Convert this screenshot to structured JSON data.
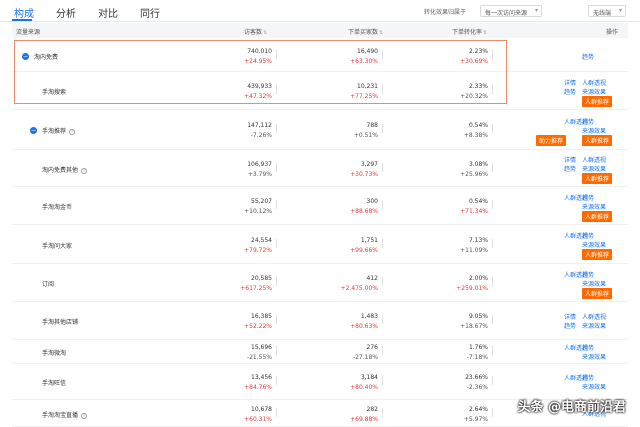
{
  "tabs": [
    {
      "label": "构成",
      "active": true
    },
    {
      "label": "分析",
      "active": false
    },
    {
      "label": "对比",
      "active": false
    },
    {
      "label": "同行",
      "active": false
    }
  ],
  "attribution_label": "转化效果归属于",
  "attribution_select": "每一次访问来源",
  "terminal_select": "无线端",
  "columns": {
    "source": "流量来源",
    "visitors": "访客数",
    "buyers": "下单买家数",
    "conversion": "下单转化率",
    "ops": "操作"
  },
  "rows": [
    {
      "name": "淘内免费",
      "level": 0,
      "expanded": true,
      "help": false,
      "visitors": "740,010",
      "visitors_chg": "+24.95%",
      "visitors_pos": true,
      "buyers": "16,490",
      "buyers_chg": "+63.30%",
      "buyers_pos": true,
      "conv": "2.23%",
      "conv_chg": "+30.69%",
      "conv_pos": true,
      "ops": {
        "links": [
          "趋势"
        ],
        "badges": []
      }
    },
    {
      "name": "手淘搜索",
      "level": 1,
      "expanded": false,
      "help": false,
      "visitors": "439,933",
      "visitors_chg": "+47.32%",
      "visitors_pos": true,
      "buyers": "10,231",
      "buyers_chg": "+77.25%",
      "buyers_pos": true,
      "conv": "2.33%",
      "conv_chg": "+20.32%",
      "conv_pos": false,
      "ops": {
        "links": [
          "详情",
          "人群透视",
          "趋势",
          "来源效果"
        ],
        "badges": [
          "人群推荐"
        ]
      }
    },
    {
      "name": "手淘推荐",
      "level": 1,
      "expanded": true,
      "help": true,
      "visitors": "147,112",
      "visitors_chg": "-7.26%",
      "visitors_pos": false,
      "buyers": "788",
      "buyers_chg": "+0.51%",
      "buyers_pos": false,
      "conv": "0.54%",
      "conv_chg": "+8.38%",
      "conv_pos": false,
      "ops": {
        "links": [
          "人群透视",
          "趋势",
          "来源效果"
        ],
        "badges": [
          "助力推荐",
          "人群推荐"
        ]
      }
    },
    {
      "name": "淘内免费其他",
      "level": 1,
      "expanded": false,
      "help": true,
      "visitors": "106,937",
      "visitors_chg": "+3.79%",
      "visitors_pos": false,
      "buyers": "3,297",
      "buyers_chg": "+30.73%",
      "buyers_pos": true,
      "conv": "3.08%",
      "conv_chg": "+25.96%",
      "conv_pos": false,
      "ops": {
        "links": [
          "详情",
          "人群透视",
          "趋势",
          "来源效果"
        ],
        "badges": [
          "人群推荐"
        ]
      }
    },
    {
      "name": "手淘淘金币",
      "level": 1,
      "expanded": false,
      "help": false,
      "visitors": "55,207",
      "visitors_chg": "+10.12%",
      "visitors_pos": false,
      "buyers": "300",
      "buyers_chg": "+88.68%",
      "buyers_pos": true,
      "conv": "0.54%",
      "conv_chg": "+71.34%",
      "conv_pos": true,
      "ops": {
        "links": [
          "人群透视",
          "趋势",
          "来源效果"
        ],
        "badges": [
          "人群推荐"
        ]
      }
    },
    {
      "name": "手淘问大家",
      "level": 1,
      "expanded": false,
      "help": false,
      "visitors": "24,554",
      "visitors_chg": "+79.72%",
      "visitors_pos": true,
      "buyers": "1,751",
      "buyers_chg": "+99.66%",
      "buyers_pos": true,
      "conv": "7.13%",
      "conv_chg": "+11.09%",
      "conv_pos": false,
      "ops": {
        "links": [
          "人群透视",
          "趋势",
          "来源效果"
        ],
        "badges": [
          "人群推荐"
        ]
      }
    },
    {
      "name": "订阅",
      "level": 1,
      "expanded": false,
      "help": false,
      "visitors": "20,585",
      "visitors_chg": "+617.25%",
      "visitors_pos": true,
      "buyers": "412",
      "buyers_chg": "+2,475.00%",
      "buyers_pos": true,
      "conv": "2.00%",
      "conv_chg": "+259.01%",
      "conv_pos": true,
      "ops": {
        "links": [
          "人群透视",
          "趋势",
          "来源效果"
        ],
        "badges": [
          "人群推荐"
        ]
      }
    },
    {
      "name": "手淘其他店铺",
      "level": 1,
      "expanded": false,
      "help": false,
      "visitors": "16,385",
      "visitors_chg": "+52.22%",
      "visitors_pos": true,
      "buyers": "1,483",
      "buyers_chg": "+80.63%",
      "buyers_pos": true,
      "conv": "9.05%",
      "conv_chg": "+18.67%",
      "conv_pos": false,
      "ops": {
        "links": [
          "详情",
          "人群透视",
          "趋势",
          "来源效果"
        ],
        "badges": []
      }
    },
    {
      "name": "手淘微淘",
      "level": 1,
      "expanded": false,
      "help": false,
      "visitors": "15,696",
      "visitors_chg": "-21.55%",
      "visitors_pos": false,
      "buyers": "276",
      "buyers_chg": "-27.18%",
      "buyers_pos": false,
      "conv": "1.76%",
      "conv_chg": "-7.18%",
      "conv_pos": false,
      "ops": {
        "links": [
          "人群透视",
          "趋势",
          "来源效果"
        ],
        "badges": []
      }
    },
    {
      "name": "手淘旺信",
      "level": 1,
      "expanded": false,
      "help": false,
      "visitors": "13,456",
      "visitors_chg": "+84.76%",
      "visitors_pos": true,
      "buyers": "3,184",
      "buyers_chg": "+80.40%",
      "buyers_pos": true,
      "conv": "23.66%",
      "conv_chg": "-2.36%",
      "conv_pos": false,
      "ops": {
        "links": [
          "人群透视",
          "趋势",
          "来源效果"
        ],
        "badges": []
      }
    },
    {
      "name": "手淘淘宝直播",
      "level": 1,
      "expanded": false,
      "help": true,
      "visitors": "10,678",
      "visitors_chg": "+60.31%",
      "visitors_pos": true,
      "buyers": "282",
      "buyers_chg": "+69.88%",
      "buyers_pos": true,
      "conv": "2.64%",
      "conv_chg": "+5.97%",
      "conv_pos": false,
      "ops": {
        "links": [
          "人群透视"
        ],
        "badges": []
      }
    }
  ],
  "watermark": "头条 @电商前沿君"
}
